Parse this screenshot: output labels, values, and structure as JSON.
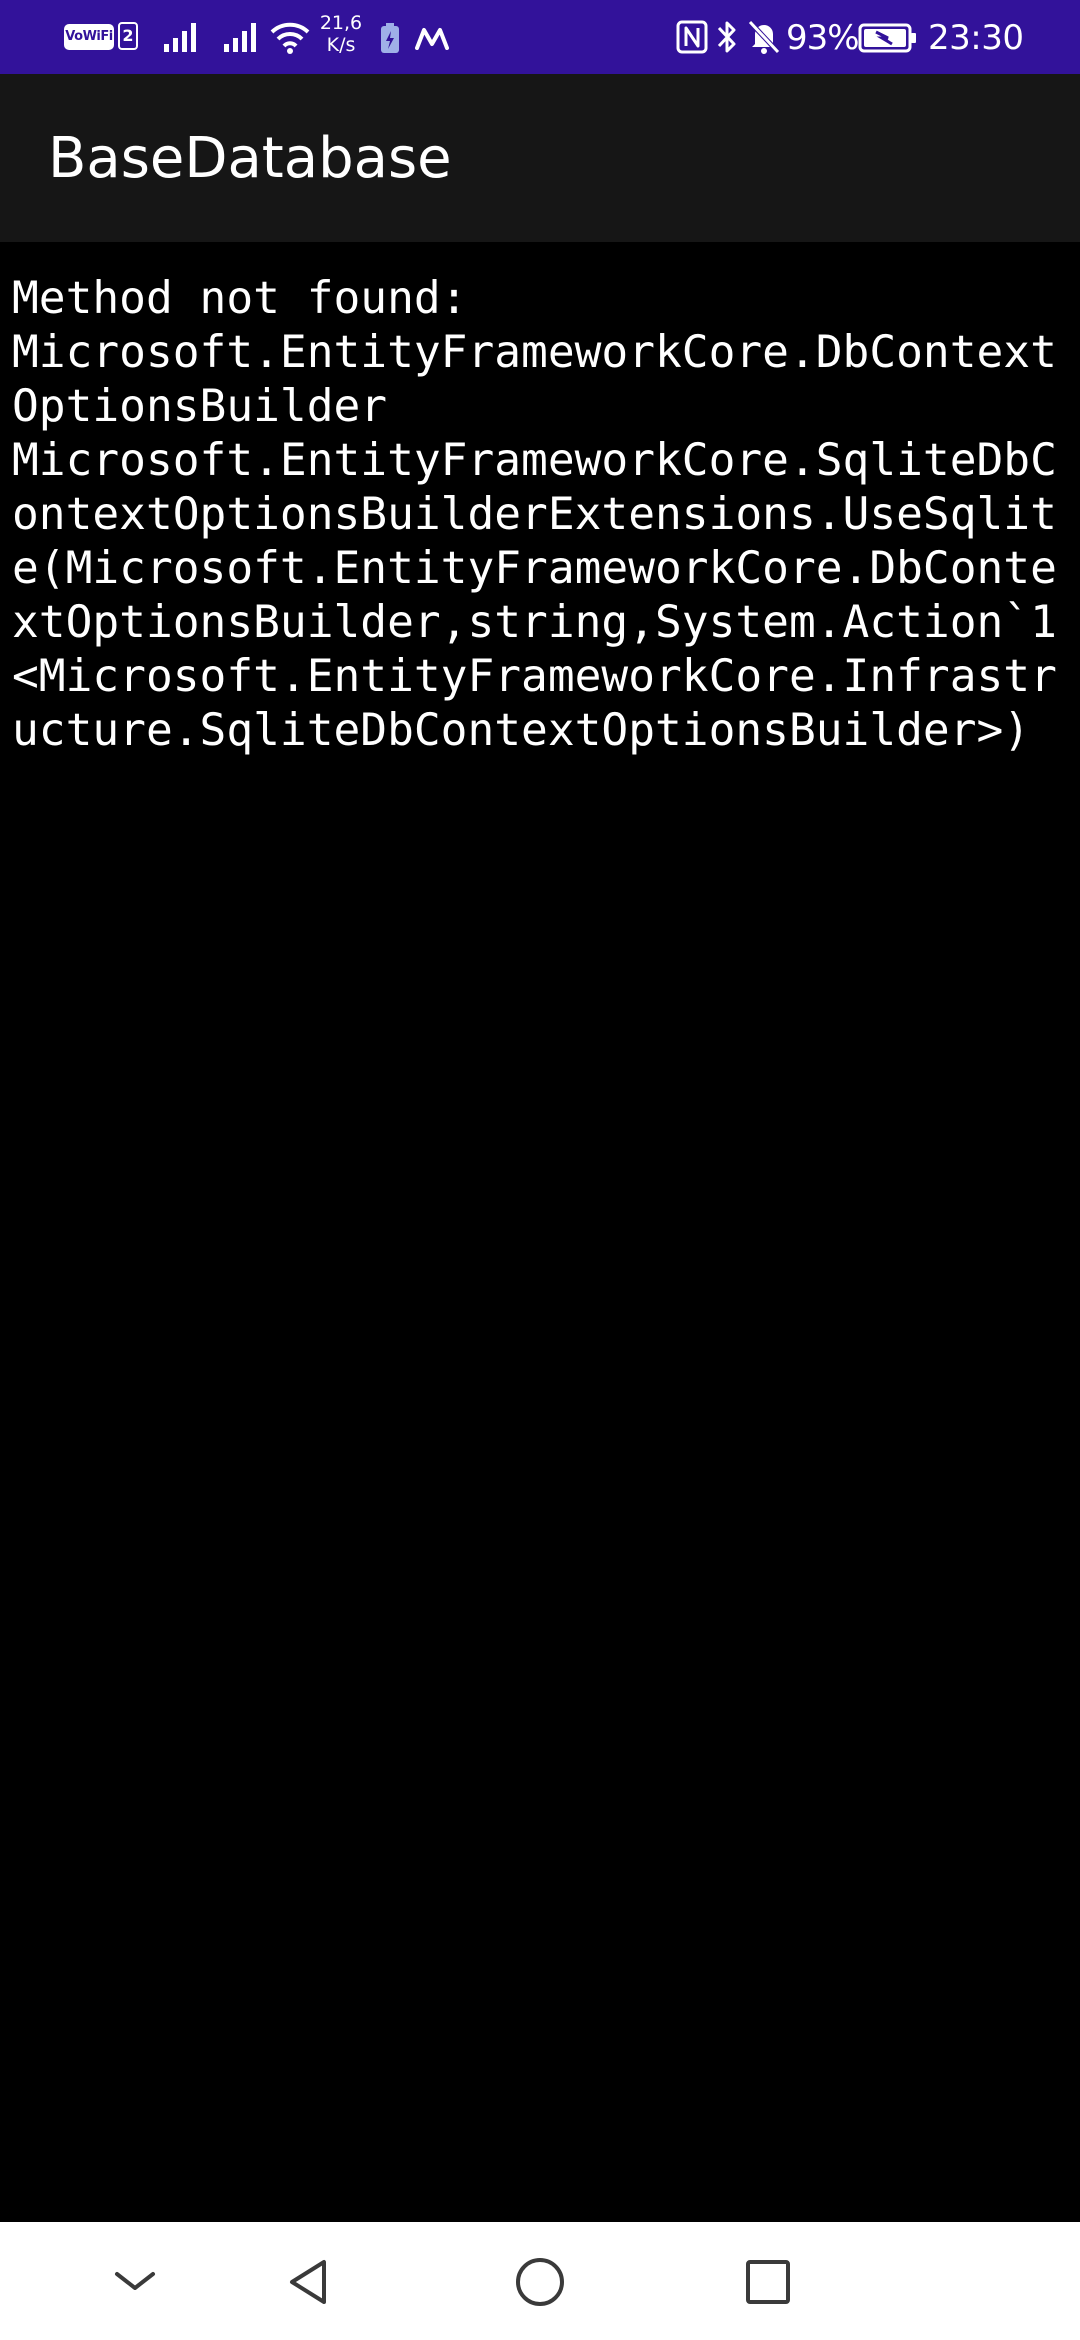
{
  "status_bar": {
    "vowifi": "VoWiFi",
    "sim_number": "2",
    "net_speed_value": "21,6",
    "net_speed_unit": "K/s",
    "battery_percent": "93%",
    "time": "23:30",
    "icons": [
      "vowifi-icon",
      "signal-icon",
      "signal-icon",
      "wifi-icon",
      "battery-saver-icon",
      "app-m-icon",
      "nfc-icon",
      "bluetooth-icon",
      "mute-icon",
      "battery-icon"
    ],
    "background": "#32129a"
  },
  "app_bar": {
    "title": "BaseDatabase",
    "background": "#161616"
  },
  "content": {
    "error_message": "Method not found:\nMicrosoft.EntityFrameworkCore.DbContextOptionsBuilder\nMicrosoft.EntityFrameworkCore.SqliteDbContextOptionsBuilderExtensions.UseSqlite(Microsoft.EntityFrameworkCore.DbContextOptionsBuilder,string,System.Action`1<Microsoft.EntityFrameworkCore.Infrastructure.SqliteDbContextOptionsBuilder>)",
    "background": "#000000",
    "text_color": "#ffffff"
  },
  "nav_bar": {
    "buttons": [
      "collapse-icon",
      "back-icon",
      "home-icon",
      "recents-icon"
    ],
    "background": "#ffffff",
    "icon_color": "#3a3a3a"
  }
}
